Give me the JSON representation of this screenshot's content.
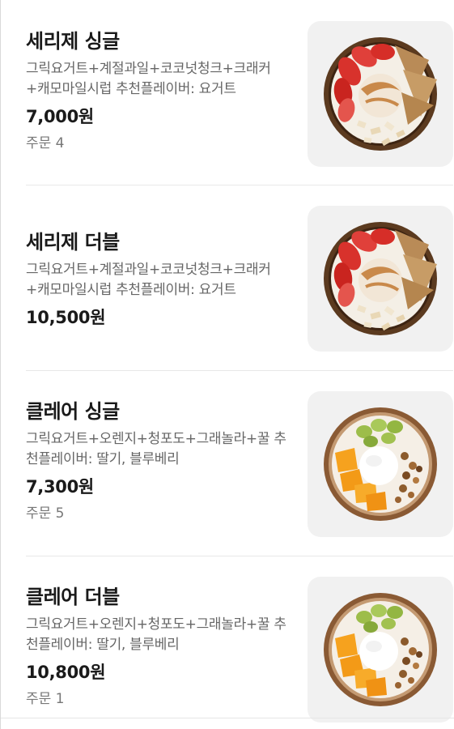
{
  "menu": {
    "items": [
      {
        "name": "세리제 싱글",
        "description": "그릭요거트+계절과일+코코넛청크+크래커+캐모마일시럽 추천플레이버: 요거트",
        "price": "7,000원",
        "orders": "주문 4",
        "image_icon": "strawberry-yogurt-bowl-icon"
      },
      {
        "name": "세리제 더블",
        "description": "그릭요거트+계절과일+코코넛청크+크래커+캐모마일시럽 추천플레이버: 요거트",
        "price": "10,500원",
        "orders": "",
        "image_icon": "strawberry-yogurt-bowl-icon"
      },
      {
        "name": "클레어 싱글",
        "description": "그릭요거트+오렌지+청포도+그래놀라+꿀 추천플레이버: 딸기, 블루베리",
        "price": "7,300원",
        "orders": "주문 5",
        "image_icon": "orange-grape-yogurt-bowl-icon"
      },
      {
        "name": "클레어 더블",
        "description": "그릭요거트+오렌지+청포도+그래놀라+꿀 추천플레이버: 딸기, 블루베리",
        "price": "10,800원",
        "orders": "주문 1",
        "image_icon": "orange-grape-yogurt-bowl-icon"
      }
    ]
  }
}
